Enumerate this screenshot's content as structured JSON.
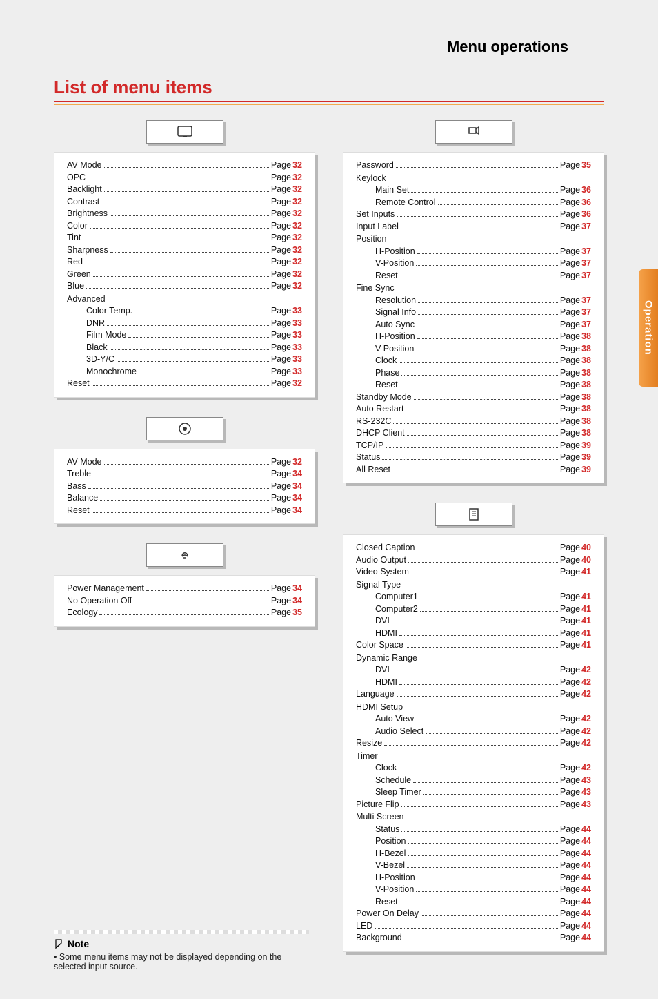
{
  "header_title": "Menu operations",
  "section_title": "List of menu items",
  "side_tab": "Operation",
  "page_word": "Page ",
  "note": {
    "title": "Note",
    "body": "• Some menu items may not be displayed depending on the selected input source."
  },
  "left_blocks": [
    {
      "icon": "picture-icon",
      "rows": [
        {
          "label": "AV Mode",
          "page": "32"
        },
        {
          "label": "OPC",
          "page": "32"
        },
        {
          "label": "Backlight",
          "page": "32"
        },
        {
          "label": "Contrast",
          "page": "32"
        },
        {
          "label": "Brightness",
          "page": "32"
        },
        {
          "label": "Color",
          "page": "32"
        },
        {
          "label": "Tint",
          "page": "32"
        },
        {
          "label": "Sharpness",
          "page": "32"
        },
        {
          "label": "Red",
          "page": "32"
        },
        {
          "label": "Green",
          "page": "32"
        },
        {
          "label": "Blue",
          "page": "32"
        },
        {
          "heading": "Advanced"
        },
        {
          "label": "Color Temp.",
          "page": "33",
          "indent": true
        },
        {
          "label": "DNR",
          "page": "33",
          "indent": true
        },
        {
          "label": "Film Mode",
          "page": "33",
          "indent": true
        },
        {
          "label": "Black",
          "page": "33",
          "indent": true
        },
        {
          "label": "3D-Y/C",
          "page": "33",
          "indent": true
        },
        {
          "label": "Monochrome",
          "page": "33",
          "indent": true
        },
        {
          "label": "Reset",
          "page": "32"
        }
      ]
    },
    {
      "icon": "audio-icon",
      "rows": [
        {
          "label": "AV Mode",
          "page": "32"
        },
        {
          "label": "Treble",
          "page": "34"
        },
        {
          "label": "Bass",
          "page": "34"
        },
        {
          "label": "Balance",
          "page": "34"
        },
        {
          "label": "Reset",
          "page": "34"
        }
      ]
    },
    {
      "icon": "power-icon",
      "rows": [
        {
          "label": "Power Management",
          "page": "34"
        },
        {
          "label": "No Operation Off",
          "page": "34"
        },
        {
          "label": "Ecology",
          "page": "35"
        }
      ]
    }
  ],
  "right_blocks": [
    {
      "icon": "setup-icon",
      "rows": [
        {
          "label": "Password",
          "page": "35"
        },
        {
          "heading": "Keylock"
        },
        {
          "label": "Main Set",
          "page": "36",
          "indent": true
        },
        {
          "label": "Remote Control",
          "page": "36",
          "indent": true
        },
        {
          "label": "Set Inputs",
          "page": "36"
        },
        {
          "label": "Input Label",
          "page": "37"
        },
        {
          "heading": "Position"
        },
        {
          "label": "H-Position",
          "page": "37",
          "indent": true
        },
        {
          "label": "V-Position",
          "page": "37",
          "indent": true
        },
        {
          "label": "Reset",
          "page": "37",
          "indent": true
        },
        {
          "heading": "Fine Sync"
        },
        {
          "label": "Resolution",
          "page": "37",
          "indent": true
        },
        {
          "label": "Signal Info",
          "page": "37",
          "indent": true
        },
        {
          "label": "Auto Sync",
          "page": "37",
          "indent": true
        },
        {
          "label": "H-Position",
          "page": "38",
          "indent": true
        },
        {
          "label": "V-Position",
          "page": "38",
          "indent": true
        },
        {
          "label": "Clock",
          "page": "38",
          "indent": true
        },
        {
          "label": "Phase",
          "page": "38",
          "indent": true
        },
        {
          "label": "Reset",
          "page": "38",
          "indent": true
        },
        {
          "label": "Standby Mode",
          "page": "38"
        },
        {
          "label": "Auto Restart",
          "page": "38"
        },
        {
          "label": "RS-232C",
          "page": "38"
        },
        {
          "label": "DHCP Client",
          "page": "38"
        },
        {
          "label": "TCP/IP",
          "page": "39"
        },
        {
          "label": "Status",
          "page": "39"
        },
        {
          "label": "All Reset",
          "page": "39"
        }
      ]
    },
    {
      "icon": "option-icon",
      "rows": [
        {
          "label": "Closed Caption",
          "page": "40"
        },
        {
          "label": "Audio Output",
          "page": "40"
        },
        {
          "label": "Video System",
          "page": "41"
        },
        {
          "heading": "Signal Type"
        },
        {
          "label": "Computer1",
          "page": "41",
          "indent": true
        },
        {
          "label": "Computer2",
          "page": "41",
          "indent": true
        },
        {
          "label": "DVI",
          "page": "41",
          "indent": true
        },
        {
          "label": "HDMI",
          "page": "41",
          "indent": true
        },
        {
          "label": "Color Space",
          "page": "41"
        },
        {
          "heading": "Dynamic Range"
        },
        {
          "label": "DVI",
          "page": "42",
          "indent": true
        },
        {
          "label": "HDMI",
          "page": "42",
          "indent": true
        },
        {
          "label": "Language",
          "page": "42"
        },
        {
          "heading": "HDMI Setup"
        },
        {
          "label": "Auto View",
          "page": "42",
          "indent": true
        },
        {
          "label": "Audio Select",
          "page": "42",
          "indent": true
        },
        {
          "label": "Resize",
          "page": "42"
        },
        {
          "heading": "Timer"
        },
        {
          "label": "Clock",
          "page": "42",
          "indent": true
        },
        {
          "label": "Schedule",
          "page": "43",
          "indent": true
        },
        {
          "label": "Sleep Timer",
          "page": "43",
          "indent": true
        },
        {
          "label": "Picture Flip",
          "page": "43"
        },
        {
          "heading": "Multi Screen"
        },
        {
          "label": "Status",
          "page": "44",
          "indent": true
        },
        {
          "label": "Position",
          "page": "44",
          "indent": true
        },
        {
          "label": "H-Bezel",
          "page": "44",
          "indent": true
        },
        {
          "label": "V-Bezel",
          "page": "44",
          "indent": true
        },
        {
          "label": "H-Position",
          "page": "44",
          "indent": true
        },
        {
          "label": "V-Position",
          "page": "44",
          "indent": true
        },
        {
          "label": "Reset",
          "page": "44",
          "indent": true
        },
        {
          "label": "Power On Delay",
          "page": "44"
        },
        {
          "label": "LED",
          "page": "44"
        },
        {
          "label": "Background",
          "page": "44"
        }
      ]
    }
  ]
}
